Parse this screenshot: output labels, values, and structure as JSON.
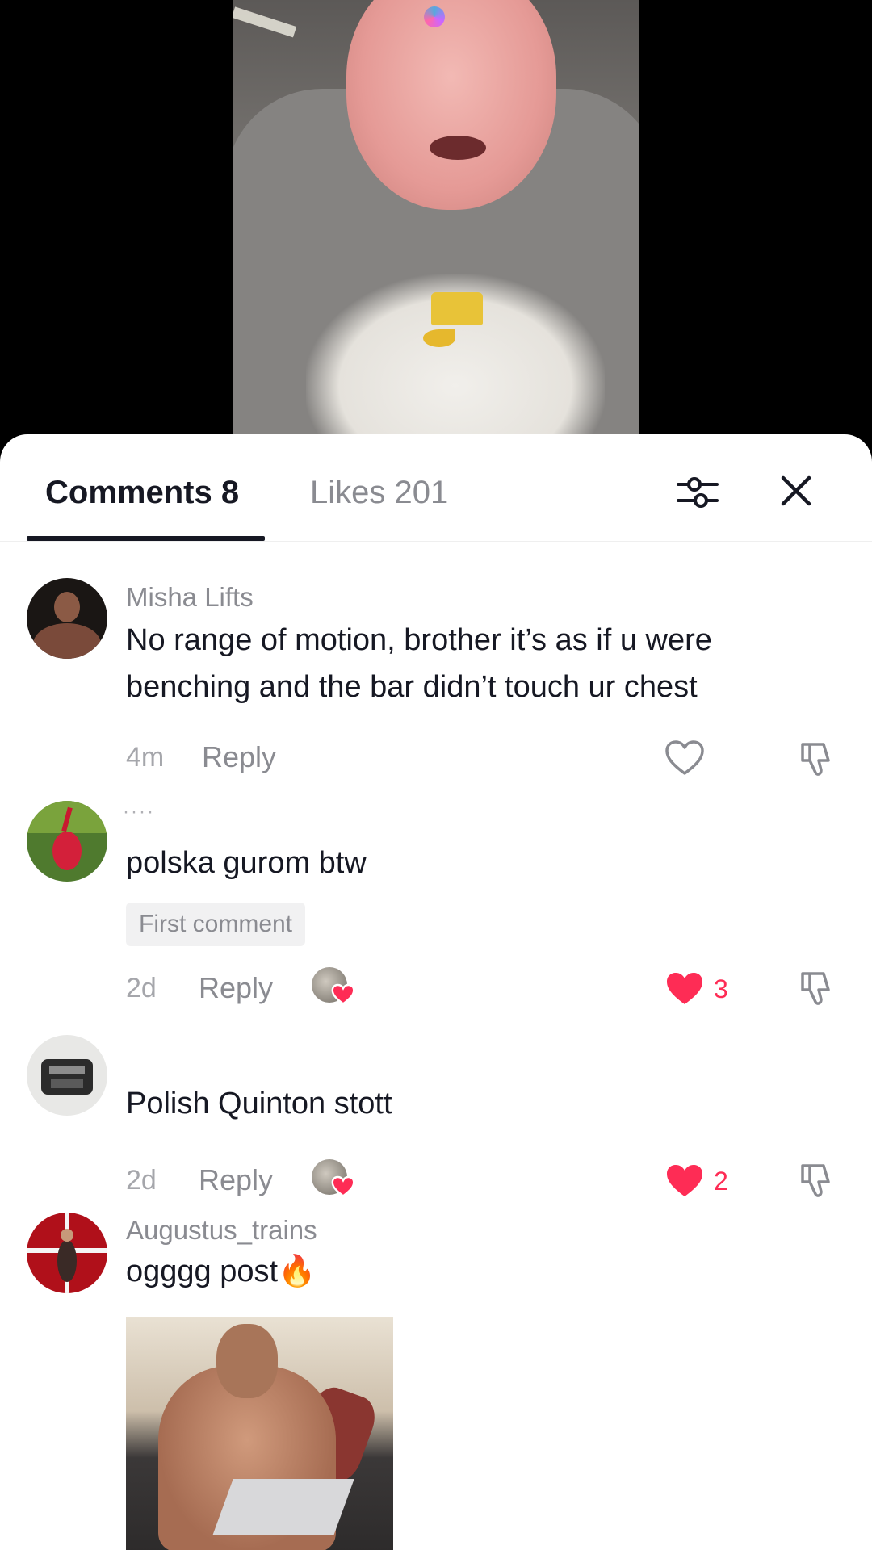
{
  "tabs": {
    "comments_label": "Comments 8",
    "likes_label": "Likes 201"
  },
  "icons": {
    "filter": "sliders-icon",
    "close": "close-icon"
  },
  "colors": {
    "like_red": "#fe2c55",
    "text_primary": "#161823",
    "text_secondary": "#8a8b91"
  },
  "comments": [
    {
      "username": "Misha Lifts",
      "text": "No range of motion, brother it’s as if u were benching and the bar didn’t touch ur chest",
      "time": "4m",
      "reply_label": "Reply",
      "likes": "",
      "liked": false
    },
    {
      "username": "",
      "text": "polska gurom btw",
      "badge": "First comment",
      "time": "2d",
      "reply_label": "Reply",
      "likes": "3",
      "liked": true,
      "creator_liked": true
    },
    {
      "username": "",
      "text": "Polish Quinton stott",
      "time": "2d",
      "reply_label": "Reply",
      "likes": "2",
      "liked": true,
      "creator_liked": true
    },
    {
      "username": "Augustus_trains",
      "text": "ogggg post🔥",
      "has_image": true
    }
  ]
}
